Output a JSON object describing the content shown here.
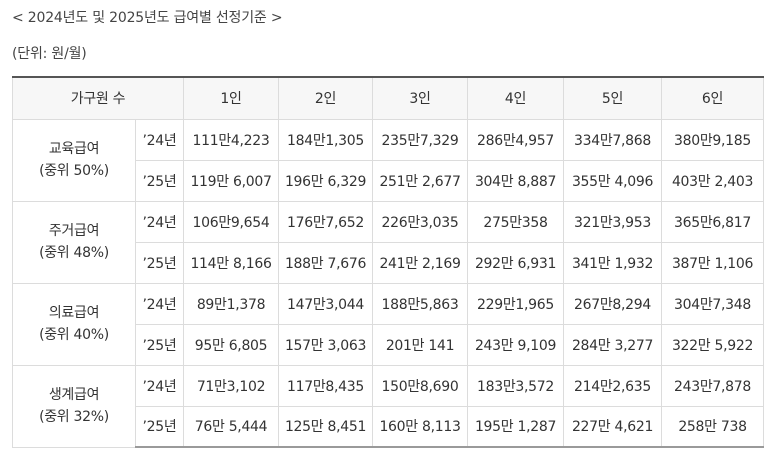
{
  "title": "< 2024년도 및 2025년도 급여별 선정기준 >",
  "unit": "(단위: 원/월)",
  "columns": [
    "가구원 수",
    "1인",
    "2인",
    "3인",
    "4인",
    "5인",
    "6인"
  ],
  "groups": [
    {
      "name": "교육급여",
      "median": "(중위 50%)",
      "rows": [
        {
          "year": "’24년",
          "values": [
            "111만4,223",
            "184만1,305",
            "235만7,329",
            "286만4,957",
            "334만7,868",
            "380만9,185"
          ]
        },
        {
          "year": "’25년",
          "values": [
            "119만 6,007",
            "196만 6,329",
            "251만 2,677",
            "304만 8,887",
            "355만 4,096",
            "403만 2,403"
          ]
        }
      ]
    },
    {
      "name": "주거급여",
      "median": "(중위 48%)",
      "rows": [
        {
          "year": "’24년",
          "values": [
            "106만9,654",
            "176만7,652",
            "226만3,035",
            "275만358",
            "321만3,953",
            "365만6,817"
          ]
        },
        {
          "year": "’25년",
          "values": [
            "114만 8,166",
            "188만 7,676",
            "241만 2,169",
            "292만 6,931",
            "341만 1,932",
            "387만 1,106"
          ]
        }
      ]
    },
    {
      "name": "의료급여",
      "median": "(중위 40%)",
      "rows": [
        {
          "year": "’24년",
          "values": [
            "89만1,378",
            "147만3,044",
            "188만5,863",
            "229만1,965",
            "267만8,294",
            "304만7,348"
          ]
        },
        {
          "year": "’25년",
          "values": [
            "95만 6,805",
            "157만 3,063",
            "201만 141",
            "243만 9,109",
            "284만 3,277",
            "322만 5,922"
          ]
        }
      ]
    },
    {
      "name": "생계급여",
      "median": "(중위 32%)",
      "rows": [
        {
          "year": "’24년",
          "values": [
            "71만3,102",
            "117만8,435",
            "150만8,690",
            "183만3,572",
            "214만2,635",
            "243만7,878"
          ]
        },
        {
          "year": "’25년",
          "values": [
            "76만 5,444",
            "125만 8,451",
            "160만 8,113",
            "195만 1,287",
            "227만 4,621",
            "258만 738"
          ]
        }
      ]
    }
  ]
}
